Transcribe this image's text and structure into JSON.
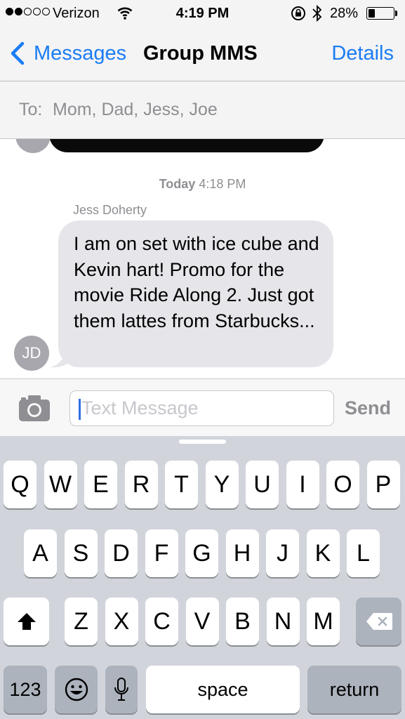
{
  "status_bar": {
    "signal_dots_filled": 2,
    "signal_dots_total": 5,
    "carrier": "Verizon",
    "time": "4:19 PM",
    "battery_percent": "28%",
    "battery_level": 0.28,
    "icons": [
      "wifi-icon",
      "rotation-lock-icon",
      "bluetooth-icon",
      "battery-icon"
    ]
  },
  "nav": {
    "back_label": "Messages",
    "title": "Group MMS",
    "details_label": "Details"
  },
  "recipients": {
    "label": "To:",
    "names": "Mom, Dad, Jess, Joe"
  },
  "conversation": {
    "timestamp_day": "Today",
    "timestamp_time": "4:18 PM",
    "sender": "Jess Doherty",
    "message": "I am on set with ice cube and Kevin hart! Promo for the movie Ride Along 2. Just got them lattes from Starbucks...",
    "avatar_initials": "JD"
  },
  "composer": {
    "placeholder": "Text Message",
    "send_label": "Send"
  },
  "keyboard": {
    "row1": [
      "Q",
      "W",
      "E",
      "R",
      "T",
      "Y",
      "U",
      "I",
      "O",
      "P"
    ],
    "row2": [
      "A",
      "S",
      "D",
      "F",
      "G",
      "H",
      "J",
      "K",
      "L"
    ],
    "row3": [
      "Z",
      "X",
      "C",
      "V",
      "B",
      "N",
      "M"
    ],
    "numbers_label": "123",
    "space_label": "space",
    "return_label": "return"
  },
  "colors": {
    "accent": "#1b7cf5",
    "bubble": "#e5e5ea",
    "keyboard_bg": "#d1d5db"
  }
}
